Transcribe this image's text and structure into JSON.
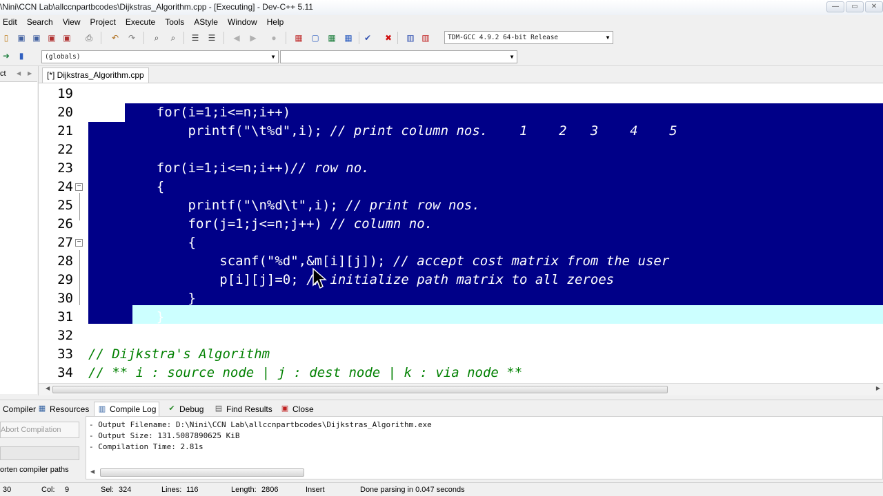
{
  "window": {
    "title": "\\Nini\\CCN Lab\\allccnpartbcodes\\Dijkstras_Algorithm.cpp - [Executing] - Dev-C++ 5.11",
    "controls": [
      "—",
      "▭",
      "✕"
    ]
  },
  "menu": [
    "Edit",
    "Search",
    "View",
    "Project",
    "Execute",
    "Tools",
    "AStyle",
    "Window",
    "Help"
  ],
  "toolbar": {
    "compiler_select": "TDM-GCC 4.9.2 64-bit Release",
    "scope_select": "(globals)",
    "member_select": ""
  },
  "left_panel": {
    "tab_label": "ct"
  },
  "editor": {
    "tab_label": "[*] Dijkstras_Algorithm.cpp",
    "lines": [
      {
        "n": "19",
        "code": "",
        "comment": ""
      },
      {
        "n": "20",
        "code": "    for(i=1;i<=n;i++)",
        "comment": ""
      },
      {
        "n": "21",
        "code": "        printf(\"\\t%d\",i); ",
        "comment": "// print column nos.    1    2   3    4    5"
      },
      {
        "n": "22",
        "code": "",
        "comment": ""
      },
      {
        "n": "23",
        "code": "    for(i=1;i<=n;i++)",
        "comment": "// row no."
      },
      {
        "n": "24",
        "code": "    {",
        "comment": ""
      },
      {
        "n": "25",
        "code": "        printf(\"\\n%d\\t\",i); ",
        "comment": "// print row nos."
      },
      {
        "n": "26",
        "code": "        for(j=1;j<=n;j++) ",
        "comment": "// column no."
      },
      {
        "n": "27",
        "code": "        {",
        "comment": ""
      },
      {
        "n": "28",
        "code": "            scanf(\"%d\",&m[i][j]); ",
        "comment": "// accept cost matrix from the user"
      },
      {
        "n": "29",
        "code": "            p[i][j]=0; ",
        "comment": "// initialize path matrix to all zeroes"
      },
      {
        "n": "30",
        "code": "        }",
        "comment": ""
      },
      {
        "n": "31",
        "code": "    }",
        "comment": ""
      },
      {
        "n": "32",
        "code": "",
        "comment": ""
      },
      {
        "n": "33",
        "code": "",
        "comment": "// Dijkstra's Algorithm"
      },
      {
        "n": "34",
        "code": "",
        "comment": "// ** i : source node | j : dest node | k : via node **"
      }
    ]
  },
  "bottom_tabs": [
    "Compiler",
    "Resources",
    "Compile Log",
    "Debug",
    "Find Results",
    "Close"
  ],
  "compile": {
    "abort_label": "Abort Compilation",
    "shorten_label": "orten compiler paths",
    "log": [
      "- Output Filename: D:\\Nini\\CCN Lab\\allccnpartbcodes\\Dijkstras_Algorithm.exe",
      "- Output Size: 131.5087890625 KiB",
      "- Compilation Time: 2.81s"
    ]
  },
  "status": {
    "line": "30",
    "col_label": "Col:",
    "col": "9",
    "sel_label": "Sel:",
    "sel": "324",
    "lines_label": "Lines:",
    "lines": "116",
    "length_label": "Length:",
    "length": "2806",
    "mode": "Insert",
    "message": "Done parsing in 0.047 seconds"
  },
  "colors": {
    "selection": "#000088",
    "current_line": "#ccffff",
    "comment": "#008000"
  }
}
